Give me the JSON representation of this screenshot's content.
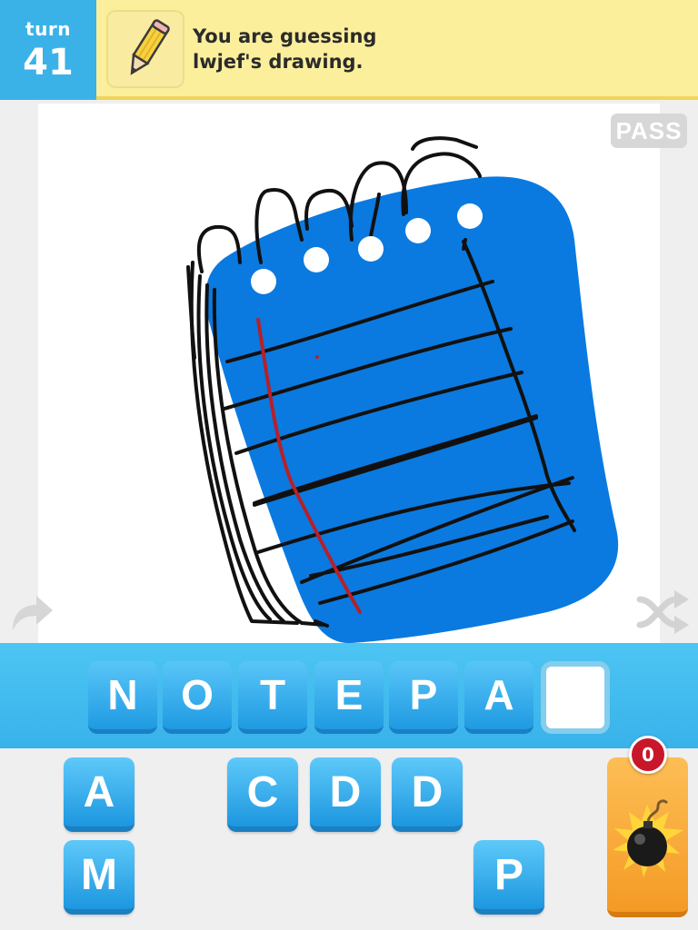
{
  "header": {
    "turn_label": "turn",
    "turn_number": "41",
    "message_line1": "You are guessing",
    "message_line2": "lwjef's drawing.",
    "icon": "pencil-icon"
  },
  "canvas": {
    "pass_label": "PASS",
    "drawing_subject": "notepad",
    "colors": {
      "page": "#0a7ae0",
      "ink": "#111111",
      "margin_line": "#b5212a",
      "holes": "#ffffff"
    }
  },
  "side_icons": {
    "left": "share-arrow-icon",
    "right": "shuffle-icon"
  },
  "answer": {
    "slots": [
      "N",
      "O",
      "T",
      "E",
      "P",
      "A",
      ""
    ]
  },
  "tiles": {
    "row1": [
      "A",
      "C",
      "D",
      "D"
    ],
    "row2": [
      "M",
      "P"
    ]
  },
  "bomb": {
    "count": "0",
    "icon": "bomb-icon"
  },
  "colors": {
    "turn_bg": "#3ab2e7",
    "header_bg": "#fbef9c",
    "tile_blue": "#1d97e0",
    "bomb_orange": "#f49a25",
    "badge_red": "#c8172a"
  }
}
